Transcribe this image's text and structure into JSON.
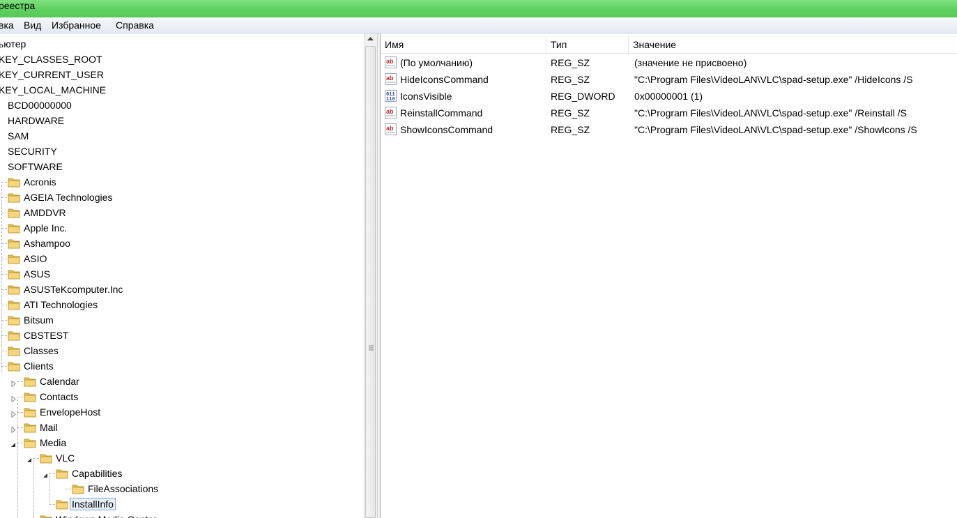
{
  "window": {
    "title": "реестра"
  },
  "menu": [
    "вка",
    "Вид",
    "Избранное",
    "Справка"
  ],
  "tree": {
    "items": [
      {
        "label": "ьютер",
        "level": 0
      },
      {
        "label": "KEY_CLASSES_ROOT",
        "level": 0
      },
      {
        "label": "KEY_CURRENT_USER",
        "level": 0
      },
      {
        "label": "KEY_LOCAL_MACHINE",
        "level": 0
      },
      {
        "label": "BCD00000000",
        "level": 1
      },
      {
        "label": "HARDWARE",
        "level": 1
      },
      {
        "label": "SAM",
        "level": 1
      },
      {
        "label": "SECURITY",
        "level": 1
      },
      {
        "label": "SOFTWARE",
        "level": 1
      },
      {
        "label": "Acronis",
        "level": 2,
        "folder": true
      },
      {
        "label": "AGEIA Technologies",
        "level": 2,
        "folder": true
      },
      {
        "label": "AMDDVR",
        "level": 2,
        "folder": true
      },
      {
        "label": "Apple Inc.",
        "level": 2,
        "folder": true
      },
      {
        "label": "Ashampoo",
        "level": 2,
        "folder": true
      },
      {
        "label": "ASIO",
        "level": 2,
        "folder": true
      },
      {
        "label": "ASUS",
        "level": 2,
        "folder": true
      },
      {
        "label": "ASUSTeKcomputer.Inc",
        "level": 2,
        "folder": true
      },
      {
        "label": "ATI Technologies",
        "level": 2,
        "folder": true
      },
      {
        "label": "Bitsum",
        "level": 2,
        "folder": true
      },
      {
        "label": "CBSTEST",
        "level": 2,
        "folder": true
      },
      {
        "label": "Classes",
        "level": 2,
        "folder": true
      },
      {
        "label": "Clients",
        "level": 2,
        "folder": true,
        "expanded": true
      },
      {
        "label": "Calendar",
        "level": 3,
        "folder": true,
        "collapsed": true
      },
      {
        "label": "Contacts",
        "level": 3,
        "folder": true,
        "collapsed": true
      },
      {
        "label": "EnvelopeHost",
        "level": 3,
        "folder": true,
        "collapsed": true
      },
      {
        "label": "Mail",
        "level": 3,
        "folder": true,
        "collapsed": true
      },
      {
        "label": "Media",
        "level": 3,
        "folder": true,
        "expanded": true
      },
      {
        "label": "VLC",
        "level": 4,
        "folder": true,
        "expanded": true
      },
      {
        "label": "Capabilities",
        "level": 5,
        "folder": true,
        "expanded": true
      },
      {
        "label": "FileAssociations",
        "level": 6,
        "folder": true
      },
      {
        "label": "InstallInfo",
        "level": 5,
        "folder": true,
        "selected": true
      },
      {
        "label": "Windows Media Center",
        "level": 4,
        "folder": true,
        "collapsed": true
      }
    ]
  },
  "list": {
    "columns": [
      "Имя",
      "Тип",
      "Значение"
    ],
    "rows": [
      {
        "name": "(По умолчанию)",
        "type": "REG_SZ",
        "value": "(значение не присвоено)",
        "icon": "string-value-icon"
      },
      {
        "name": "HideIconsCommand",
        "type": "REG_SZ",
        "value": "\"C:\\Program Files\\VideoLAN\\VLC\\spad-setup.exe\" /HideIcons /S",
        "icon": "string-value-icon"
      },
      {
        "name": "IconsVisible",
        "type": "REG_DWORD",
        "value": "0x00000001 (1)",
        "icon": "binary-value-icon"
      },
      {
        "name": "ReinstallCommand",
        "type": "REG_SZ",
        "value": "\"C:\\Program Files\\VideoLAN\\VLC\\spad-setup.exe\" /Reinstall /S",
        "icon": "string-value-icon"
      },
      {
        "name": "ShowIconsCommand",
        "type": "REG_SZ",
        "value": "\"C:\\Program Files\\VideoLAN\\VLC\\spad-setup.exe\" /ShowIcons /S",
        "icon": "string-value-icon"
      }
    ]
  },
  "colors": {
    "titlebar": "#5fd05f",
    "selection_border": "#7da2ce",
    "folder": "#e8c15a"
  }
}
